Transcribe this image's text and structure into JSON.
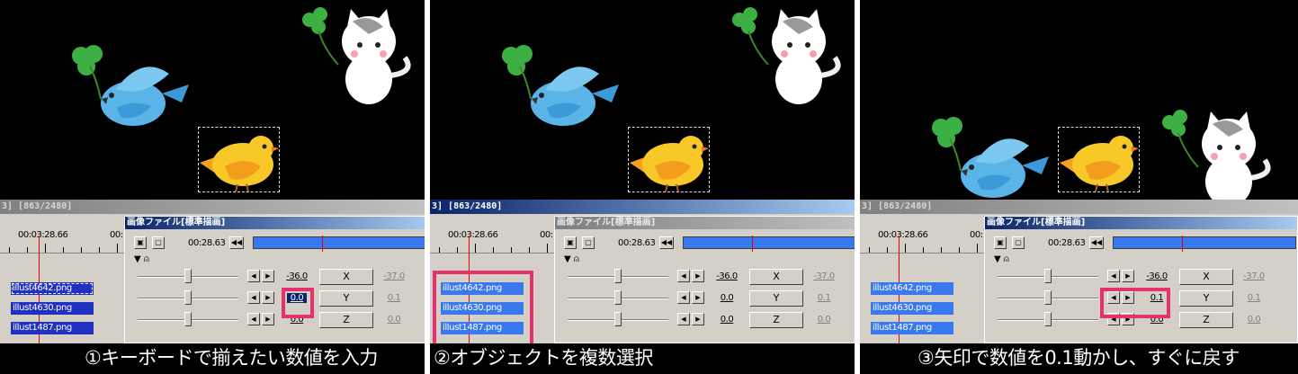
{
  "panels": [
    {
      "timeline_header": "3] [863/2480]",
      "timeline_time_1": "00:03:28.66",
      "timeline_time_2": "00:",
      "layers": [
        "illust4642.png",
        "illust4630.png",
        "illust1487.png"
      ],
      "dialog_title": "画像ファイル[標準描画]",
      "dialog_active": true,
      "dialog_time": "00:28.63",
      "rows": [
        {
          "value": "-36.0",
          "axis": "X",
          "right": "-37.0"
        },
        {
          "value": "0.0",
          "axis": "Y",
          "right": "0.1"
        },
        {
          "value": "0.0",
          "axis": "Z",
          "right": "0.0"
        }
      ],
      "caption": "①キーボードで揃えたい数値を入力"
    },
    {
      "timeline_header": "3] [863/2480]",
      "timeline_time_1": "00:03:28.66",
      "timeline_time_2": "00:",
      "layers": [
        "illust4642.png",
        "illust4630.png",
        "illust1487.png"
      ],
      "dialog_title": "画像ファイル[標準描画]",
      "dialog_active": false,
      "dialog_time": "00:28.63",
      "rows": [
        {
          "value": "-36.0",
          "axis": "X",
          "right": "-37.0"
        },
        {
          "value": "0.0",
          "axis": "Y",
          "right": "0.1"
        },
        {
          "value": "0.0",
          "axis": "Z",
          "right": "0.0"
        }
      ],
      "caption": "②オブジェクトを複数選択"
    },
    {
      "timeline_header": "3] [863/2480]",
      "timeline_time_1": "00:03:28.66",
      "timeline_time_2": "00:",
      "layers": [
        "illust4642.png",
        "illust4630.png",
        "illust1487.png"
      ],
      "dialog_title": "画像ファイル[標準描画]",
      "dialog_active": true,
      "dialog_time": "00:28.63",
      "rows": [
        {
          "value": "-36.0",
          "axis": "X",
          "right": "-37.0"
        },
        {
          "value": "0.1",
          "axis": "Y",
          "right": "0.1"
        },
        {
          "value": "0.0",
          "axis": "Z",
          "right": "0.0"
        }
      ],
      "caption": "③矢印で数値を0.1動かし、すぐに戻す"
    }
  ],
  "colors": {
    "highlight": "#e8306c",
    "layer_selected": "#3a78f0",
    "layer_default": "#2030c0",
    "win_face": "#d4d0c8"
  }
}
